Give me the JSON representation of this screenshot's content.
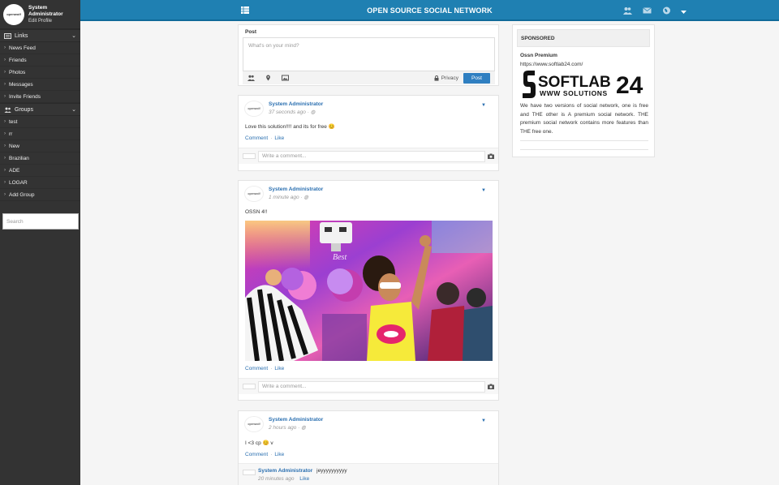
{
  "sidebar": {
    "user_name": "System Administrator",
    "edit_profile": "Edit Profile",
    "avatar_text": "openwolf",
    "links_header": "Links",
    "links": [
      {
        "label": "News Feed"
      },
      {
        "label": "Friends"
      },
      {
        "label": "Photos"
      },
      {
        "label": "Messages"
      },
      {
        "label": "Invite Friends"
      }
    ],
    "groups_header": "Groups",
    "groups": [
      {
        "label": "test"
      },
      {
        "label": "rr"
      },
      {
        "label": "New"
      },
      {
        "label": "Brazilian"
      },
      {
        "label": "ADE"
      },
      {
        "label": "LOGAR"
      },
      {
        "label": "Add Group"
      }
    ],
    "search_placeholder": "Search"
  },
  "topbar": {
    "title": "OPEN SOURCE SOCIAL NETWORK",
    "icons": [
      "menu-icon",
      "friends-icon",
      "messages-icon",
      "notifications-globe-icon",
      "chevron-down-icon"
    ]
  },
  "composer": {
    "header": "Post",
    "placeholder": "What's on your mind?",
    "privacy_label": "Privacy",
    "post_label": "Post"
  },
  "posts": [
    {
      "author": "System Administrator",
      "time": "37 seconds ago",
      "text": "Love this solution!!!! and its for free",
      "emoji": "😊",
      "comment_label": "Comment",
      "like_label": "Like",
      "comment_placeholder": "Write a comment..."
    },
    {
      "author": "System Administrator",
      "time": "1 minute ago",
      "text": "OSSN 4!!",
      "comment_label": "Comment",
      "like_label": "Like",
      "comment_placeholder": "Write a comment..."
    },
    {
      "author": "System Administrator",
      "time": "2 hours ago",
      "text": "I <3 cp",
      "text_after_emoji": "v",
      "emoji": "😊",
      "comment_label": "Comment",
      "like_label": "Like",
      "reply": {
        "author": "System Administrator",
        "text": "jeyyyyyyyyyy",
        "time": "20 minutes ago",
        "like_label": "Like"
      }
    }
  ],
  "sponsored": {
    "header": "SPONSORED",
    "title": "Ossn Premium",
    "url": "https://www.softlab24.com/",
    "logo_main": "SOFTLAB",
    "logo_num": "24",
    "logo_sub": "WWW SOLUTIONS",
    "description": "We have two versions of social network, one is free and THE other is A premium social network. THE premium social network contains more features than THE free one."
  },
  "colors": {
    "topbar": "#1f80b2",
    "sidebar": "#333333",
    "link": "#2a6fb0",
    "post_button": "#2f7fc1"
  }
}
